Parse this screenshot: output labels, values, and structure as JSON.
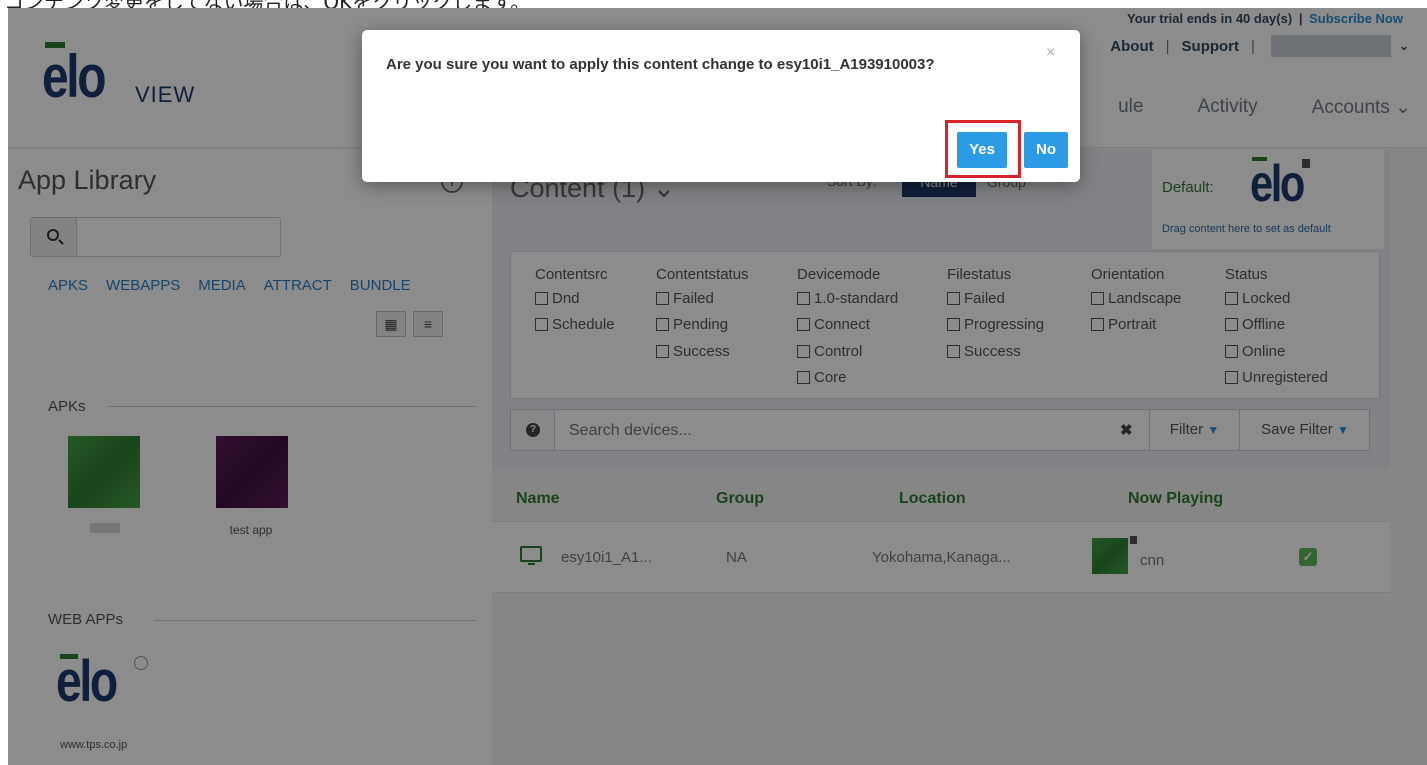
{
  "caption": "コンテンツ変更をしてない場合は、OKをクリックします。",
  "header": {
    "logo_text": "elo",
    "logo_sub": "VIEW",
    "trial_text": "Your trial ends in 40 day(s)",
    "trial_sep": "|",
    "subscribe": "Subscribe Now",
    "top_links": [
      "About",
      "Support"
    ],
    "main_nav": [
      "ule",
      "Activity",
      "Accounts ⌄"
    ]
  },
  "app_library": {
    "title": "App Library",
    "search_placeholder": "",
    "categories": [
      "APKS",
      "WEBAPPS",
      "MEDIA",
      "ATTRACT",
      "BUNDLE"
    ],
    "apks_label": "APKs",
    "apk_items": [
      {
        "label": ""
      },
      {
        "label": "test app"
      }
    ],
    "webapps_label": "WEB APPs",
    "webapp_logo": "elo",
    "webapp_url": "www.tps.co.jp"
  },
  "content": {
    "title": "Content (1) ⌄",
    "sort_by": "Sort By:",
    "sort_name": "Name",
    "sort_group": "Group",
    "default_label": "Default:",
    "default_logo": "elo",
    "default_hint": "Drag content here to set as default"
  },
  "filters": [
    {
      "header": "Contentsrc",
      "options": [
        "Dnd",
        "Schedule"
      ]
    },
    {
      "header": "Contentstatus",
      "options": [
        "Failed",
        "Pending",
        "Success"
      ]
    },
    {
      "header": "Devicemode",
      "options": [
        "1.0-standard",
        "Connect",
        "Control",
        "Core"
      ]
    },
    {
      "header": "Filestatus",
      "options": [
        "Failed",
        "Progressing",
        "Success"
      ]
    },
    {
      "header": "Orientation",
      "options": [
        "Landscape",
        "Portrait"
      ]
    },
    {
      "header": "Status",
      "options": [
        "Locked",
        "Offline",
        "Online",
        "Unregistered"
      ]
    }
  ],
  "search": {
    "placeholder": "Search devices...",
    "filter_label": "Filter",
    "save_filter_label": "Save Filter"
  },
  "table": {
    "headers": [
      "Name",
      "Group",
      "Location",
      "Now Playing"
    ],
    "rows": [
      {
        "name": "esy10i1_A1...",
        "group": "NA",
        "location": "Yokohama,Kanaga...",
        "now_playing": "cnn",
        "checked": true
      }
    ]
  },
  "modal": {
    "message": "Are you sure you want to apply this content change to esy10i1_A193910003?",
    "close": "×",
    "yes_label": "Yes",
    "no_label": "No"
  }
}
